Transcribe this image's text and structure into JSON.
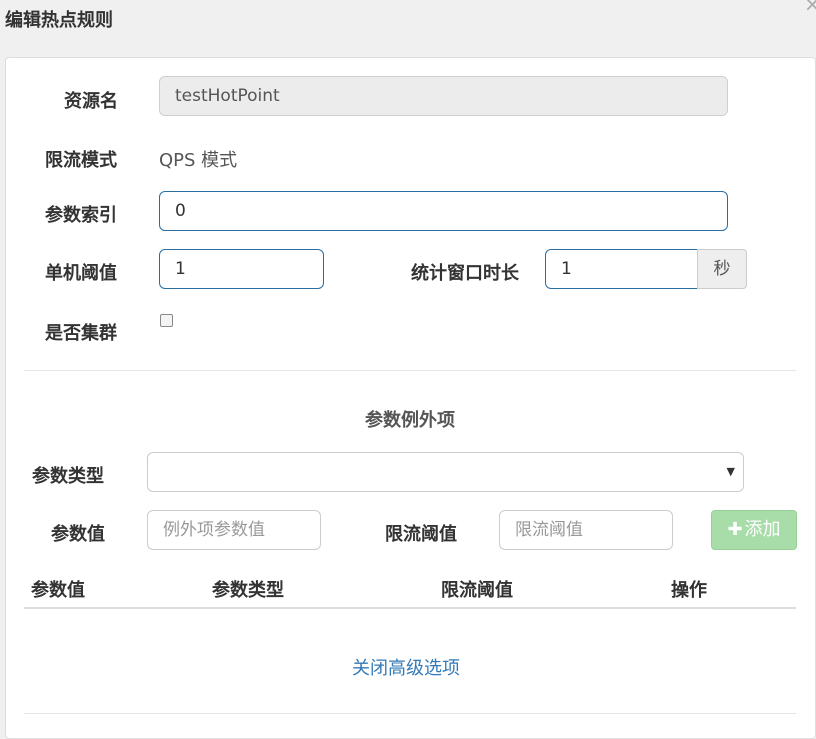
{
  "dialog": {
    "title": "编辑热点规则",
    "close_glyph": "×"
  },
  "form": {
    "resource_label": "资源名",
    "resource_value": "testHotPoint",
    "mode_label": "限流模式",
    "mode_value": "QPS 模式",
    "param_index_label": "参数索引",
    "param_index_value": "0",
    "threshold_label": "单机阈值",
    "threshold_value": "1",
    "window_label": "统计窗口时长",
    "window_value": "1",
    "window_unit": "秒",
    "cluster_label": "是否集群"
  },
  "exceptions": {
    "title": "参数例外项",
    "type_label": "参数类型",
    "type_selected": "",
    "value_label": "参数值",
    "value_placeholder": "例外项参数值",
    "limit_label": "限流阈值",
    "limit_placeholder": "限流阈值",
    "add_label": "添加",
    "add_icon": "plus-icon"
  },
  "table": {
    "columns": [
      "参数值",
      "参数类型",
      "限流阈值",
      "操作"
    ]
  },
  "advanced_toggle": "关闭高级选项",
  "colors": {
    "primary": "#337ab7",
    "success_disabled": "#a8dca8",
    "focus_border": "#2c6da0"
  }
}
